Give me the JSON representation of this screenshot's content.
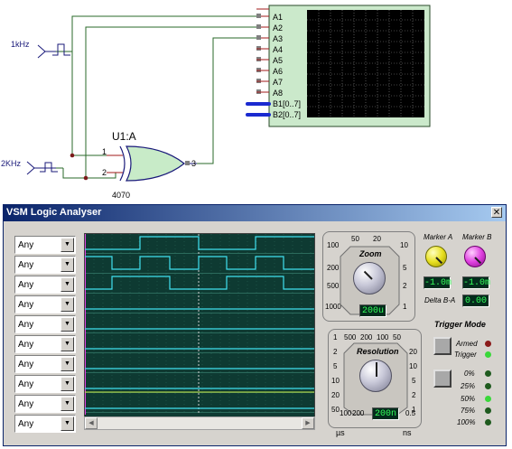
{
  "schematic": {
    "clock1_label": "1kHz",
    "clock2_label": "2KHz",
    "gate_ref": "U1:A",
    "gate_part": "4070",
    "gate_pin_in1": "1",
    "gate_pin_in2": "2",
    "gate_pin_out": "3",
    "analyser_pins": [
      "A1",
      "A2",
      "A3",
      "A4",
      "A5",
      "A6",
      "A7",
      "A8",
      "B1[0..7]",
      "B2[0..7]"
    ]
  },
  "window": {
    "title": "VSM Logic Analyser",
    "close_glyph": "✕"
  },
  "channels": [
    {
      "value": "Any"
    },
    {
      "value": "Any"
    },
    {
      "value": "Any"
    },
    {
      "value": "Any"
    },
    {
      "value": "Any"
    },
    {
      "value": "Any"
    },
    {
      "value": "Any"
    },
    {
      "value": "Any"
    },
    {
      "value": "Any"
    },
    {
      "value": "Any"
    }
  ],
  "channel_arrow_glyph": "▼",
  "scroll_left_glyph": "◀",
  "scroll_right_glyph": "▶",
  "zoom": {
    "label": "Zoom",
    "top_ticks": [
      "50",
      "20"
    ],
    "left_ticks": [
      "100",
      "200",
      "500",
      "1000"
    ],
    "right_ticks": [
      "10",
      "5",
      "2",
      "1"
    ],
    "value": "200u"
  },
  "resolution": {
    "label": "Resolution",
    "top_ticks": [
      "1",
      "500",
      "200",
      "100",
      "50"
    ],
    "left_ticks": [
      "2",
      "5",
      "10",
      "20",
      "50"
    ],
    "right_ticks": [
      "20",
      "10",
      "5",
      "2",
      "1"
    ],
    "bottom_ticks": [
      "100",
      "200",
      "0.5"
    ],
    "value": "200n",
    "unit_left": "µs",
    "unit_right": "ns"
  },
  "marker_a": {
    "label": "Marker A",
    "value": "-1.0m",
    "color": "#e8e020"
  },
  "marker_b": {
    "label": "Marker B",
    "value": "-1.0m",
    "color": "#e040e0"
  },
  "delta": {
    "label": "Delta B-A",
    "value": "0.00"
  },
  "trigger": {
    "title": "Trigger Mode",
    "armed_label": "Armed",
    "trigger_label": "Trigger",
    "pretrigger_levels": [
      "0%",
      "25%",
      "50%",
      "75%",
      "100%"
    ],
    "armed_led_color": "#8a1a1a",
    "trigger_led_color": "#3ad83a",
    "selected_level": "50%"
  },
  "trace_color": "#40e0f0",
  "grid_color": "#2b6a5c"
}
